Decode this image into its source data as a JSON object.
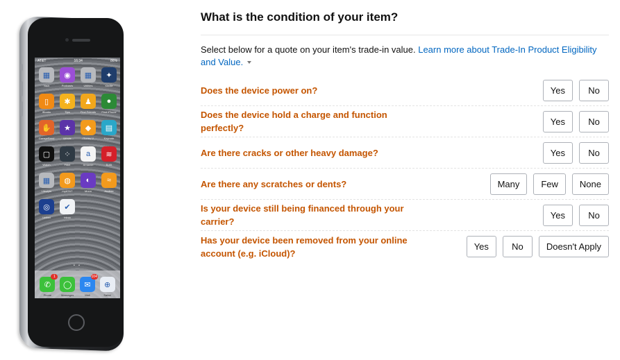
{
  "product_image": {
    "alt": "iPhone product image",
    "statusbar": {
      "carrier": "AT&T",
      "time": "16:34",
      "battery": "86%"
    },
    "apps": [
      {
        "label": "Vault",
        "icon": "folder-icon",
        "color": "#b7b9bd",
        "glyph": "▦"
      },
      {
        "label": "Podcasts",
        "icon": "podcasts-icon",
        "color": "#9b4fd6",
        "glyph": "◉"
      },
      {
        "label": "Utilities",
        "icon": "folder-icon",
        "color": "#b7b9bd",
        "glyph": "▦"
      },
      {
        "label": "Kindle",
        "icon": "kindle-icon",
        "color": "#1f3d6b",
        "glyph": "✦"
      },
      {
        "label": "iBooks",
        "icon": "ibooks-icon",
        "color": "#f08a14",
        "glyph": "▯"
      },
      {
        "label": "Tips",
        "icon": "tips-icon",
        "color": "#f5b21e",
        "glyph": "✱"
      },
      {
        "label": "Find Friends",
        "icon": "find-friends-icon",
        "color": "#f2a71c",
        "glyph": "♟"
      },
      {
        "label": "Find iPhone",
        "icon": "find-iphone-icon",
        "color": "#2c8a36",
        "glyph": "●"
      },
      {
        "label": "GarageBand",
        "icon": "garageband-icon",
        "color": "#e2642a",
        "glyph": "✋"
      },
      {
        "label": "iMovie",
        "icon": "imovie-icon",
        "color": "#5b33a8",
        "glyph": "★"
      },
      {
        "label": "iTunes U",
        "icon": "itunes-u-icon",
        "color": "#f39b1c",
        "glyph": "◆"
      },
      {
        "label": "Keynote",
        "icon": "keynote-icon",
        "color": "#2aa7c9",
        "glyph": "▤"
      },
      {
        "label": "Watch",
        "icon": "watch-icon",
        "color": "#111111",
        "glyph": "▢"
      },
      {
        "label": "Fitbit",
        "icon": "fitbit-icon",
        "color": "#2f3a44",
        "glyph": "⁘"
      },
      {
        "label": "Amazon",
        "icon": "amazon-icon",
        "color": "#f4f4f4",
        "glyph": "a"
      },
      {
        "label": "BofA",
        "icon": "bank-of-america-icon",
        "color": "#d42029",
        "glyph": "≋"
      },
      {
        "label": "Lifestyle",
        "icon": "folder-icon",
        "color": "#b7b9bd",
        "glyph": "▦"
      },
      {
        "label": "myAT&T",
        "icon": "att-icon",
        "color": "#f39a1d",
        "glyph": "◍"
      },
      {
        "label": "Moon",
        "icon": "moon-icon",
        "color": "#6a3bc2",
        "glyph": "◐"
      },
      {
        "label": "Audible",
        "icon": "audible-icon",
        "color": "#f39a1d",
        "glyph": "≈"
      },
      {
        "label": "United",
        "icon": "united-icon",
        "color": "#1c3f8f",
        "glyph": "◎"
      },
      {
        "label": "Inbox",
        "icon": "inbox-icon",
        "color": "#f1f3f6",
        "glyph": "✔"
      }
    ],
    "dock": [
      {
        "label": "Phone",
        "icon": "phone-icon",
        "color": "#3cc13b",
        "glyph": "✆",
        "badge": "1"
      },
      {
        "label": "Messages",
        "icon": "messages-icon",
        "color": "#3cc13b",
        "glyph": "◯",
        "badge": ""
      },
      {
        "label": "Mail",
        "icon": "mail-icon",
        "color": "#2b87f0",
        "glyph": "✉",
        "badge": "104"
      },
      {
        "label": "Safari",
        "icon": "safari-icon",
        "color": "#e9eef5",
        "glyph": "⊕",
        "badge": ""
      }
    ]
  },
  "condition": {
    "title": "What is the condition of your item?",
    "intro_text": "Select below for a quote on your item's trade-in value. ",
    "intro_link": "Learn more about Trade-In Product Eligibility and Value.",
    "questions": [
      {
        "text": "Does the device power on?",
        "options": [
          "Yes",
          "No"
        ]
      },
      {
        "text": "Does the device hold a charge and function perfectly?",
        "options": [
          "Yes",
          "No"
        ]
      },
      {
        "text": "Are there cracks or other heavy damage?",
        "options": [
          "Yes",
          "No"
        ]
      },
      {
        "text": "Are there any scratches or dents?",
        "options": [
          "Many",
          "Few",
          "None"
        ]
      },
      {
        "text": "Is your device still being financed through your carrier?",
        "options": [
          "Yes",
          "No"
        ]
      },
      {
        "text": "Has your device been removed from your online account (e.g. iCloud)?",
        "options": [
          "Yes",
          "No",
          "Doesn't Apply"
        ]
      }
    ]
  },
  "colors": {
    "question_text": "#c45500",
    "link": "#0066c0",
    "button_border": "#adb1b8"
  }
}
